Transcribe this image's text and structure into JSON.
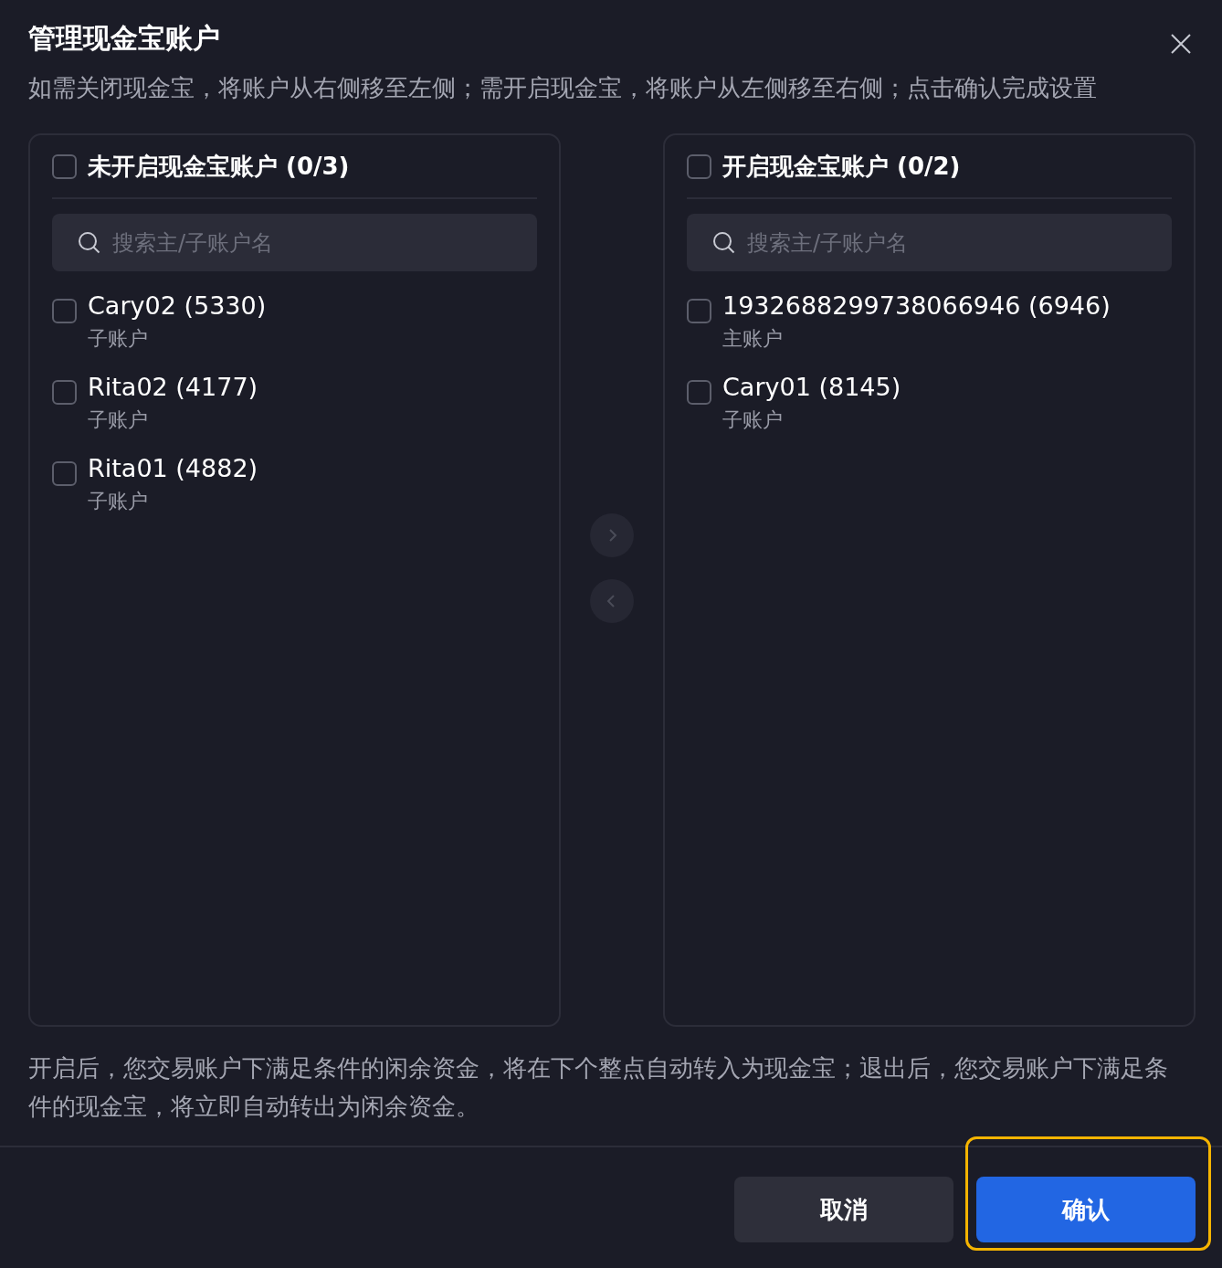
{
  "dialog": {
    "title": "管理现金宝账户",
    "description": "如需关闭现金宝，将账户从右侧移至左侧；需开启现金宝，将账户从左侧移至右侧；点击确认完成设置"
  },
  "panels": [
    {
      "title": "未开启现金宝账户 (0/3)",
      "checked": false,
      "search": {
        "placeholder": "搜索主/子账户名"
      },
      "items": [
        {
          "name": "Cary02 (5330)",
          "type": "子账户",
          "checked": false
        },
        {
          "name": "Rita02 (4177)",
          "type": "子账户",
          "checked": false
        },
        {
          "name": "Rita01 (4882)",
          "type": "子账户",
          "checked": false
        }
      ]
    },
    {
      "title": "开启现金宝账户 (0/2)",
      "checked": false,
      "search": {
        "placeholder": "搜索主/子账户名"
      },
      "items": [
        {
          "name": "1932688299738066946 (6946)",
          "type": "主账户",
          "checked": false
        },
        {
          "name": "Cary01 (8145)",
          "type": "子账户",
          "checked": false
        }
      ]
    }
  ],
  "transfer_buttons": [
    {
      "kind": "right",
      "disabled": true
    },
    {
      "kind": "left",
      "disabled": true
    }
  ],
  "note": "开启后，您交易账户下满足条件的闲余资金，将在下个整点自动转入为现金宝；退出后，您交易账户下满足条件的现金宝，将立即自动转出为闲余资金。",
  "buttons": [
    {
      "label": "取消",
      "kind": "secondary",
      "highlighted": false
    },
    {
      "label": "确认",
      "kind": "primary",
      "highlighted": true
    }
  ]
}
